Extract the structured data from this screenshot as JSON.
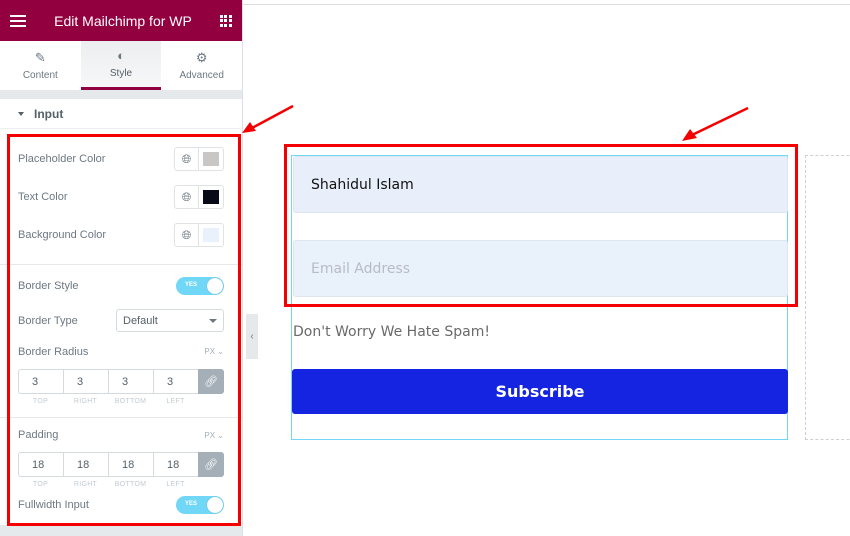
{
  "header": {
    "title": "Edit Mailchimp for WP"
  },
  "tabs": [
    {
      "label": "Content",
      "icon": "pencil-icon"
    },
    {
      "label": "Style",
      "icon": "contrast-icon",
      "active": true
    },
    {
      "label": "Advanced",
      "icon": "gear-icon"
    }
  ],
  "section": {
    "title": "Input"
  },
  "controls": {
    "placeholder_color": {
      "label": "Placeholder Color",
      "value": "#c8c7c5"
    },
    "text_color": {
      "label": "Text Color",
      "value": "#090a18"
    },
    "background_color": {
      "label": "Background Color",
      "value": "#e8f1fc"
    },
    "border_style": {
      "label": "Border Style",
      "toggle": "YES"
    },
    "border_type": {
      "label": "Border Type",
      "value": "Default"
    },
    "border_radius": {
      "label": "Border Radius",
      "unit": "PX",
      "values": [
        "3",
        "3",
        "3",
        "3"
      ]
    },
    "padding": {
      "label": "Padding",
      "unit": "PX",
      "values": [
        "18",
        "18",
        "18",
        "18"
      ]
    },
    "fullwidth": {
      "label": "Fullwidth Input",
      "toggle": "YES"
    }
  },
  "dim_labels": [
    "TOP",
    "RIGHT",
    "BOTTOM",
    "LEFT"
  ],
  "preview": {
    "name_value": "Shahidul Islam",
    "email_placeholder": "Email Address",
    "note": "Don't Worry We Hate Spam!",
    "button": "Subscribe"
  },
  "colors": {
    "brand": "#93003f",
    "button": "#1524e1",
    "annotation": "#f50000",
    "toggle": "#71d7f7"
  }
}
